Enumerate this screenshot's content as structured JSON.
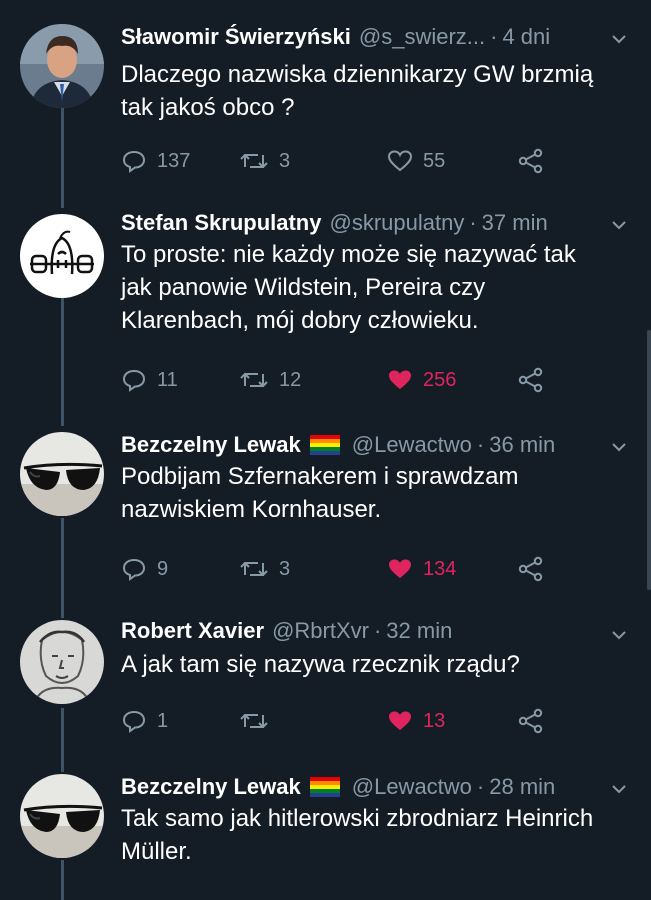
{
  "tweets": [
    {
      "name": "Sławomir Świerzyński",
      "handle": "@s_swierz...",
      "dot": "·",
      "time": "4 dni",
      "text": "Dlaczego nazwiska dziennikarzy GW brzmią\ntak jakoś obco ?",
      "replies": "137",
      "retweets": "3",
      "likes": "55",
      "liked": false,
      "has_flag": false,
      "avatar_icon": "person-photo"
    },
    {
      "name": "Stefan Skrupulatny",
      "handle": "@skrupulatny",
      "dot": "·",
      "time": "37 min",
      "text": "To proste: nie każdy może się nazywać tak\njak panowie Wildstein, Pereira czy\nKlarenbach, mój dobry człowieku.",
      "replies": "11",
      "retweets": "12",
      "likes": "256",
      "liked": true,
      "has_flag": false,
      "avatar_icon": "cartoon-face-drawing"
    },
    {
      "name": "Bezczelny Lewak",
      "handle": "@Lewactwo",
      "dot": "·",
      "time": "36 min",
      "text": "Podbijam Szfernakerem i sprawdzam\nnazwiskiem Kornhauser.",
      "replies": "9",
      "retweets": "3",
      "likes": "134",
      "liked": true,
      "has_flag": true,
      "avatar_icon": "sunglasses"
    },
    {
      "name": "Robert Xavier",
      "handle": "@RbrtXvr",
      "dot": "·",
      "time": "32 min",
      "text": "A jak tam się nazywa rzecznik rządu?",
      "replies": "1",
      "retweets": "",
      "likes": "13",
      "liked": true,
      "has_flag": false,
      "avatar_icon": "sketch-portrait"
    },
    {
      "name": "Bezczelny Lewak",
      "handle": "@Lewactwo",
      "dot": "·",
      "time": "28 min",
      "text": "Tak samo jak hitlerowski zbrodniarz Heinrich\nMüller.",
      "has_flag": true,
      "avatar_icon": "sunglasses"
    }
  ],
  "colors": {
    "background": "#141d26",
    "secondary_text": "#8899a6",
    "like_active": "#e0245e",
    "thread_line": "#3d5466"
  },
  "rainbow_flag": [
    "#e40303",
    "#ff8c00",
    "#ffed00",
    "#008026",
    "#24408e"
  ]
}
